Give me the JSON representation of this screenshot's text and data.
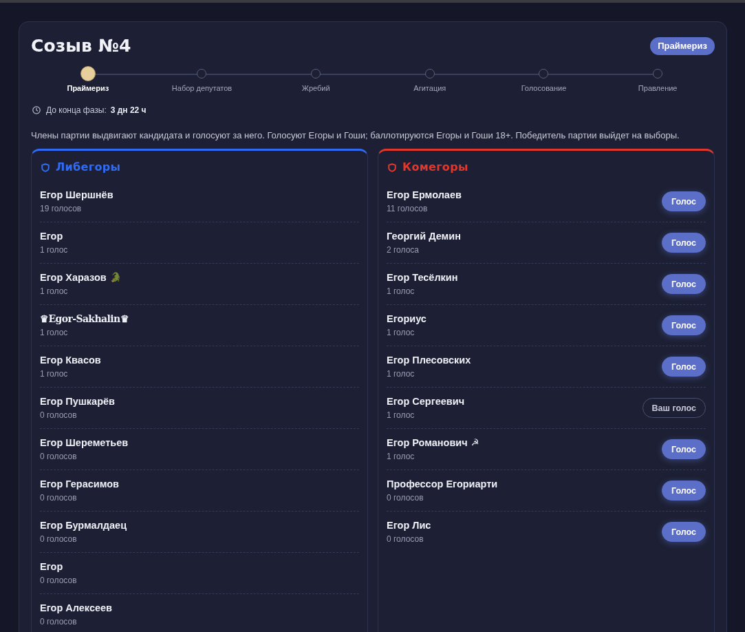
{
  "header": {
    "title": "Созыв №4",
    "phase_badge": "Праймериз"
  },
  "steps": [
    {
      "label": "Праймериз",
      "selected": true
    },
    {
      "label": "Набор депутатов",
      "selected": false
    },
    {
      "label": "Жребий",
      "selected": false
    },
    {
      "label": "Агитация",
      "selected": false
    },
    {
      "label": "Голосование",
      "selected": false
    },
    {
      "label": "Правление",
      "selected": false
    }
  ],
  "timer": {
    "label": "До конца фазы:",
    "value": "3 дн 22 ч"
  },
  "description": "Члены партии выдвигают кандидата и голосуют за него. Голосуют Егоры и Гоши; баллотируются Егоры и Гоши 18+. Победитель партии выйдет на выборы.",
  "parties": [
    {
      "name": "Либегоры",
      "color": "#2f6bf5",
      "candidates": [
        {
          "kind": "plain",
          "name": "Егор Шершнёв",
          "votes": "19 голосов"
        },
        {
          "kind": "plain",
          "name": "Егор",
          "votes": "1 голос"
        },
        {
          "kind": "plain",
          "name": "Егор Харазов",
          "emoji": "🐊",
          "votes": "1 голос"
        },
        {
          "kind": "fancy",
          "name": "♛Egor-Sakhalin♛",
          "votes": "1 голос"
        },
        {
          "kind": "plain",
          "name": "Егор Квасов",
          "votes": "1 голос"
        },
        {
          "kind": "plain",
          "name": "Егор Пушкарёв",
          "votes": "0 голосов"
        },
        {
          "kind": "plain",
          "name": "Егор Шереметьев",
          "votes": "0 голосов"
        },
        {
          "kind": "plain",
          "name": "Егор Герасимов",
          "votes": "0 голосов"
        },
        {
          "kind": "plain",
          "name": "Егор Бурмалдаец",
          "votes": "0 голосов"
        },
        {
          "kind": "plain",
          "name": "Егор",
          "votes": "0 голосов"
        },
        {
          "kind": "plain",
          "name": "Егор Алексеев",
          "votes": "0 голосов"
        }
      ]
    },
    {
      "name": "Комегоры",
      "color": "#e2372d",
      "candidates": [
        {
          "kind": "plain",
          "name": "Егор Ермолаев",
          "votes": "11 голосов",
          "button": {
            "label": "Голос",
            "selected": false
          }
        },
        {
          "kind": "plain",
          "name": "Георгий Демин",
          "votes": "2 голоса",
          "button": {
            "label": "Голос",
            "selected": false
          }
        },
        {
          "kind": "plain",
          "name": "Егор Тесёлкин",
          "votes": "1 голос",
          "button": {
            "label": "Голос",
            "selected": false
          }
        },
        {
          "kind": "plain",
          "name": "Егориус",
          "votes": "1 голос",
          "button": {
            "label": "Голос",
            "selected": false
          }
        },
        {
          "kind": "plain",
          "name": "Егор Плесовских",
          "votes": "1 голос",
          "button": {
            "label": "Голос",
            "selected": false
          }
        },
        {
          "kind": "plain",
          "name": "Егор Сергеевич",
          "votes": "1 голос",
          "button": {
            "label": "Ваш голос",
            "selected": true
          }
        },
        {
          "kind": "plain",
          "name": "Егор Романович",
          "emoji": "☭",
          "votes": "1 голос",
          "button": {
            "label": "Голос",
            "selected": false
          }
        },
        {
          "kind": "plain",
          "name": "Профессор Егориарти",
          "votes": "0 голосов",
          "button": {
            "label": "Голос",
            "selected": false
          }
        },
        {
          "kind": "plain",
          "name": "Егор Лис",
          "votes": "0 голосов",
          "button": {
            "label": "Голос",
            "selected": false
          }
        }
      ]
    }
  ]
}
